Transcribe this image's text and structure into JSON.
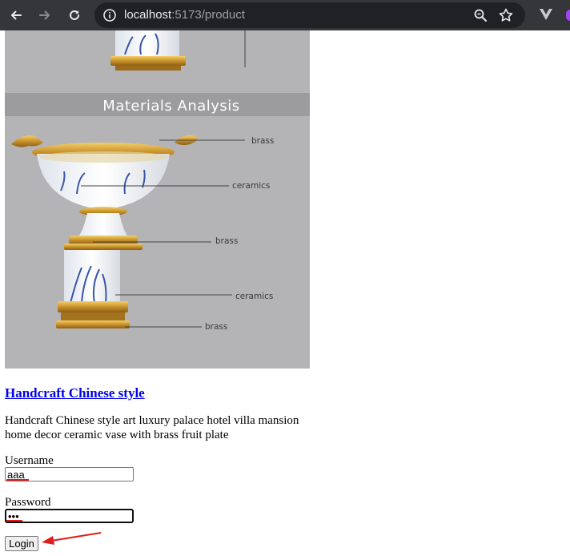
{
  "browser": {
    "url_host": "localhost",
    "url_path": ":5173/product",
    "icons": [
      "back-arrow-icon",
      "forward-arrow-icon",
      "reload-icon",
      "site-info-icon",
      "zoom-icon",
      "bookmark-star-icon",
      "extension-icon"
    ]
  },
  "product": {
    "image": {
      "heading": "Materials Analysis",
      "callouts": [
        "brass",
        "ceramics",
        "brass",
        "ceramics",
        "brass"
      ]
    },
    "title": "Handcraft Chinese style",
    "description": "Handcraft Chinese style art luxury palace hotel villa mansion home decor ceramic vase with brass fruit plate"
  },
  "login": {
    "username_label": "Username",
    "username_value": "aaa",
    "password_label": "Password",
    "password_value": "aaa",
    "button_label": "Login"
  },
  "colors": {
    "chrome_bg": "#35363a",
    "omnibox_bg": "#202124",
    "image_bg": "#b4b3b6",
    "link": "#0000ee",
    "annotation": "#e01b1b"
  }
}
